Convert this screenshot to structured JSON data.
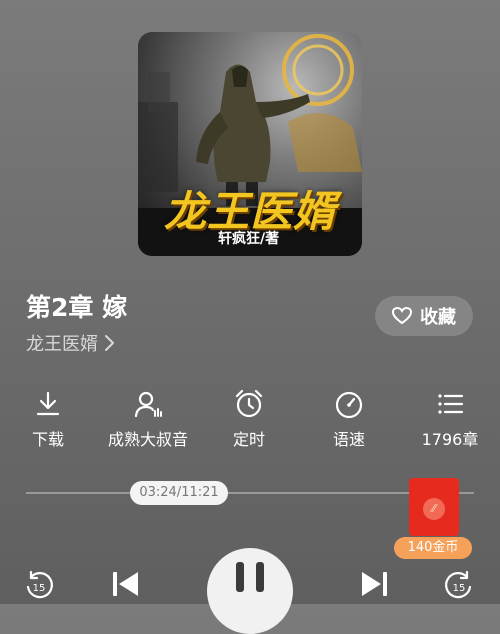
{
  "cover": {
    "title": "龙王医婿",
    "author": "轩疯狂/著"
  },
  "chapter": {
    "title": "第2章 嫁"
  },
  "book": {
    "name": "龙王医婿"
  },
  "favorite": {
    "label": "收藏",
    "icon": "heart-outline-icon"
  },
  "tools": [
    {
      "label": "下载",
      "icon": "download-icon"
    },
    {
      "label": "成熟大叔音",
      "icon": "voice-person-icon"
    },
    {
      "label": "定时",
      "icon": "alarm-clock-icon"
    },
    {
      "label": "语速",
      "icon": "speed-gauge-icon"
    },
    {
      "label": "1796章",
      "icon": "chapter-list-icon"
    }
  ],
  "progress": {
    "time_label": "03:24/11:21",
    "fraction": 0.3
  },
  "reward": {
    "coin_label": "140金币",
    "icon": "red-packet-icon"
  },
  "controls": {
    "rewind_seconds": "15",
    "forward_seconds": "15",
    "state": "playing"
  },
  "colors": {
    "background": "#6e6e6e",
    "title_gold": "#f2c521",
    "red_packet": "#e62b1e",
    "coin_badge": "#f6a15a"
  }
}
